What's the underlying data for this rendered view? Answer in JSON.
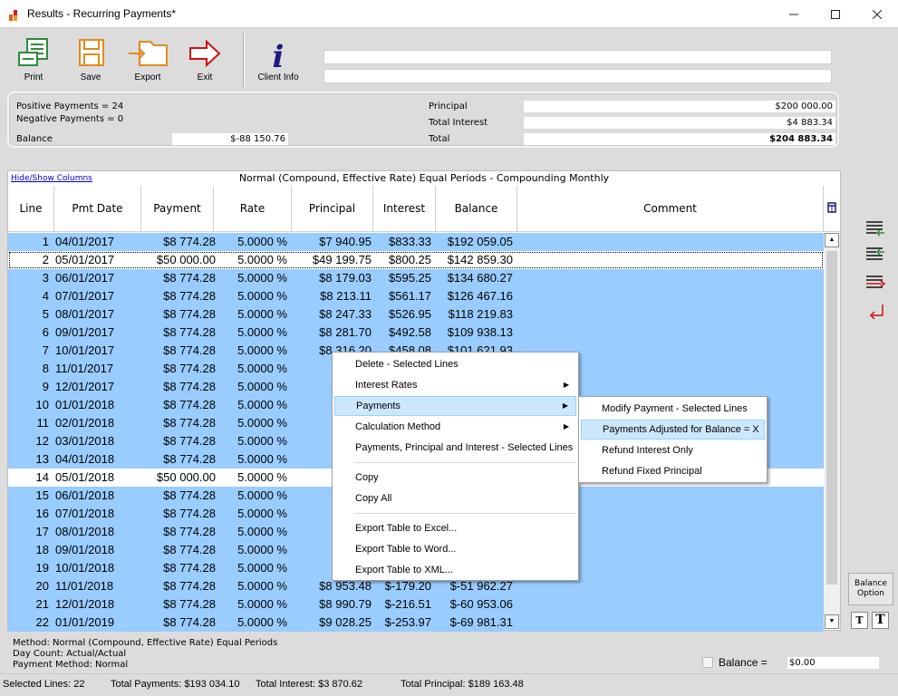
{
  "window": {
    "title": "Results - Recurring Payments*"
  },
  "toolbar": {
    "print": "Print",
    "save": "Save",
    "export": "Export",
    "exit": "Exit",
    "client_info": "Client Info"
  },
  "summary": {
    "positive_payments": "Positive Payments = 24",
    "negative_payments": "Negative Payments = 0",
    "balance_label": "Balance",
    "balance_value": "$-88 150.76",
    "principal_label": "Principal",
    "principal_value": "$200 000.00",
    "total_interest_label": "Total Interest",
    "total_interest_value": "$4 883.34",
    "total_label": "Total",
    "total_value": "$204 883.34"
  },
  "grid": {
    "hide_show_columns": "Hide/Show Columns",
    "title": "Normal (Compound, Effective Rate) Equal Periods - Compounding Monthly",
    "columns": [
      "Line",
      "Pmt Date",
      "Payment",
      "Rate",
      "Principal",
      "Interest",
      "Balance",
      "Comment"
    ],
    "rows": [
      [
        "1",
        "04/01/2017",
        "$8 774.28",
        "5.0000 %",
        "$7 940.95",
        "$833.33",
        "$192 059.05",
        ""
      ],
      [
        "2",
        "05/01/2017",
        "$50 000.00",
        "5.0000 %",
        "$49 199.75",
        "$800.25",
        "$142 859.30",
        ""
      ],
      [
        "3",
        "06/01/2017",
        "$8 774.28",
        "5.0000 %",
        "$8 179.03",
        "$595.25",
        "$134 680.27",
        ""
      ],
      [
        "4",
        "07/01/2017",
        "$8 774.28",
        "5.0000 %",
        "$8 213.11",
        "$561.17",
        "$126 467.16",
        ""
      ],
      [
        "5",
        "08/01/2017",
        "$8 774.28",
        "5.0000 %",
        "$8 247.33",
        "$526.95",
        "$118 219.83",
        ""
      ],
      [
        "6",
        "09/01/2017",
        "$8 774.28",
        "5.0000 %",
        "$8 281.70",
        "$492.58",
        "$109 938.13",
        ""
      ],
      [
        "7",
        "10/01/2017",
        "$8 774.28",
        "5.0000 %",
        "$8 316.20",
        "$458.08",
        "$101 621.93",
        ""
      ],
      [
        "8",
        "11/01/2017",
        "$8 774.28",
        "5.0000 %",
        "$8",
        "",
        "",
        ""
      ],
      [
        "9",
        "12/01/2017",
        "$8 774.28",
        "5.0000 %",
        "$8",
        "",
        "",
        ""
      ],
      [
        "10",
        "01/01/2018",
        "$8 774.28",
        "5.0000 %",
        "$8",
        "",
        "",
        ""
      ],
      [
        "11",
        "02/01/2018",
        "$8 774.28",
        "5.0000 %",
        "$8",
        "",
        "",
        ""
      ],
      [
        "12",
        "03/01/2018",
        "$8 774.28",
        "5.0000 %",
        "$8",
        "",
        "",
        ""
      ],
      [
        "13",
        "04/01/2018",
        "$8 774.28",
        "5.0000 %",
        "$8",
        "",
        "",
        ""
      ],
      [
        "14",
        "05/01/2018",
        "$50 000.00",
        "5.0000 %",
        "$49",
        "",
        "",
        ""
      ],
      [
        "15",
        "06/01/2018",
        "$8 774.28",
        "5.0000 %",
        "$8",
        "",
        "",
        ""
      ],
      [
        "16",
        "07/01/2018",
        "$8 774.28",
        "5.0000 %",
        "$8",
        "",
        "",
        ""
      ],
      [
        "17",
        "08/01/2018",
        "$8 774.28",
        "5.0000 %",
        "$8",
        "",
        "",
        ""
      ],
      [
        "18",
        "09/01/2018",
        "$8 774.28",
        "5.0000 %",
        "$8",
        "",
        "",
        ""
      ],
      [
        "19",
        "10/01/2018",
        "$8 774.28",
        "5.0000 %",
        "$8",
        "",
        "",
        ""
      ],
      [
        "20",
        "11/01/2018",
        "$8 774.28",
        "5.0000 %",
        "$8 953.48",
        "$-179.20",
        "$-51 962.27",
        ""
      ],
      [
        "21",
        "12/01/2018",
        "$8 774.28",
        "5.0000 %",
        "$8 990.79",
        "$-216.51",
        "$-60 953.06",
        ""
      ],
      [
        "22",
        "01/01/2019",
        "$8 774.28",
        "5.0000 %",
        "$9 028.25",
        "$-253.97",
        "$-69 981.31",
        ""
      ]
    ],
    "unselected_rows": [
      2,
      14
    ],
    "focused_row": 2
  },
  "context_menu": {
    "items": [
      {
        "label": "Delete - Selected Lines",
        "submenu": false
      },
      {
        "label": "Interest Rates",
        "submenu": true
      },
      {
        "label": "Payments",
        "submenu": true,
        "highlighted": true
      },
      {
        "label": "Calculation Method",
        "submenu": true
      },
      {
        "label": "Payments, Principal and Interest - Selected Lines",
        "submenu": false
      },
      {
        "label": "Copy",
        "submenu": false
      },
      {
        "label": "Copy All",
        "submenu": false
      },
      {
        "label": "Export Table to Excel...",
        "submenu": false
      },
      {
        "label": "Export Table to Word...",
        "submenu": false
      },
      {
        "label": "Export Table to XML...",
        "submenu": false
      }
    ],
    "submenu_items": [
      {
        "label": "Modify Payment - Selected Lines"
      },
      {
        "label": "Payments Adjusted for Balance = X",
        "highlighted": true
      },
      {
        "label": "Refund Interest Only"
      },
      {
        "label": "Refund Fixed Principal"
      }
    ]
  },
  "bottom": {
    "method": "Method: Normal (Compound, Effective Rate) Equal Periods",
    "day_count": "Day Count: Actual/Actual",
    "payment_method": "Payment Method: Normal",
    "balance_option": "Balance Option",
    "balance_label": "Balance =",
    "balance_input": "$0.00",
    "t_small": "T",
    "t_large": "T"
  },
  "status": {
    "selected_lines": "Selected Lines: 22",
    "total_payments": "Total Payments: $193 034.10",
    "total_interest": "Total Interest: $3 870.62",
    "total_principal": "Total Principal: $189 163.48"
  },
  "colors": {
    "selected_row": "#99ccff",
    "menu_highlight": "#cce8ff",
    "icon_green": "#2e8b3a",
    "icon_orange": "#e08a1e",
    "icon_red": "#cc1111",
    "icon_navy": "#1a1a80"
  },
  "icons": [
    "print-icon",
    "save-icon",
    "export-icon",
    "exit-icon",
    "info-icon",
    "column-chooser-icon",
    "insert-line-icon",
    "insert-line-below-icon",
    "delete-line-icon",
    "undo-icon"
  ]
}
